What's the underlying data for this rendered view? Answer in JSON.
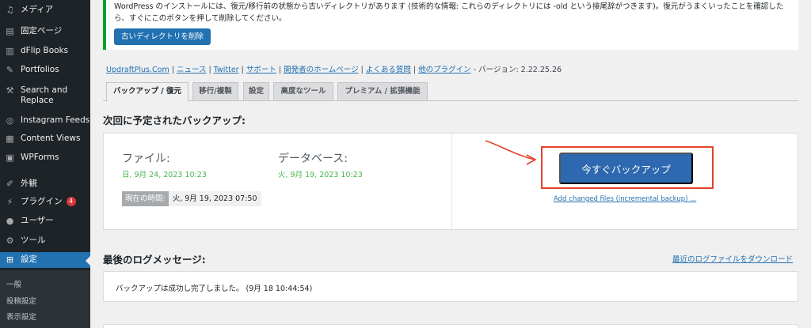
{
  "sidebar": {
    "items": [
      {
        "label": "メディア",
        "icon": "media-icon",
        "glyph": "♫"
      },
      {
        "label": "固定ページ",
        "icon": "page-icon",
        "glyph": "▤"
      },
      {
        "label": "dFlip Books",
        "icon": "book-icon",
        "glyph": "▥"
      },
      {
        "label": "Portfolios",
        "icon": "pin-icon",
        "glyph": "✎"
      },
      {
        "label": "Search and Replace",
        "icon": "wrench-icon",
        "glyph": "⚒"
      },
      {
        "label": "Instagram Feeds",
        "icon": "instagram-icon",
        "glyph": "◎"
      },
      {
        "label": "Content Views",
        "icon": "grid-icon",
        "glyph": "▦"
      },
      {
        "label": "WPForms",
        "icon": "forms-icon",
        "glyph": "▣"
      },
      {
        "label": "外観",
        "icon": "brush-icon",
        "glyph": "✐"
      },
      {
        "label": "プラグイン",
        "icon": "plugin-icon",
        "glyph": "⚡",
        "badge": "4"
      },
      {
        "label": "ユーザー",
        "icon": "user-icon",
        "glyph": "●"
      },
      {
        "label": "ツール",
        "icon": "tools-icon",
        "glyph": "⚙"
      },
      {
        "label": "設定",
        "icon": "settings-icon",
        "glyph": "⊞",
        "current": true
      }
    ],
    "submenu": [
      "一般",
      "投稿設定",
      "表示設定"
    ]
  },
  "notice": {
    "text": "WordPress のインストールには、復元/移行前の状態から古いディレクトリがあります (技術的な情報: これらのディレクトリには -old という接尾辞がつきます)。復元がうまくいったことを確認したら、すぐにこのボタンを押して削除してください。",
    "button": "古いディレクトリを削除"
  },
  "links": {
    "items": [
      "UpdraftPlus.Com",
      "ニュース",
      "Twitter",
      "サポート",
      "開発者のホームページ",
      "よくある質問",
      "他のプラグイン"
    ],
    "version": "- バージョン: 2.22.25.26"
  },
  "tabs": [
    "バックアップ / 復元",
    "移行/複製",
    "設定",
    "高度なツール",
    "プレミアム / 拡張機能"
  ],
  "scheduled": {
    "heading": "次回に予定されたバックアップ:",
    "files_label": "ファイル:",
    "files_date": "日, 9月 24, 2023 10:23",
    "db_label": "データベース:",
    "db_date": "火, 9月 19, 2023 10:23",
    "now_label": "現在の時間:",
    "now_value": "火, 9月 19, 2023 07:50",
    "backup_button": "今すぐバックアップ",
    "incremental_link": "Add changed files (incremental backup) ..."
  },
  "log": {
    "heading": "最後のログメッセージ:",
    "download_link": "最近のログファイルをダウンロード",
    "message": "バックアップは成功し完了しました。 (9月 18 10:44:54)"
  },
  "colors": {
    "accent": "#2271b1",
    "success": "#46b450",
    "highlight": "#e2432a",
    "sidebar_bg": "#1d2327"
  }
}
